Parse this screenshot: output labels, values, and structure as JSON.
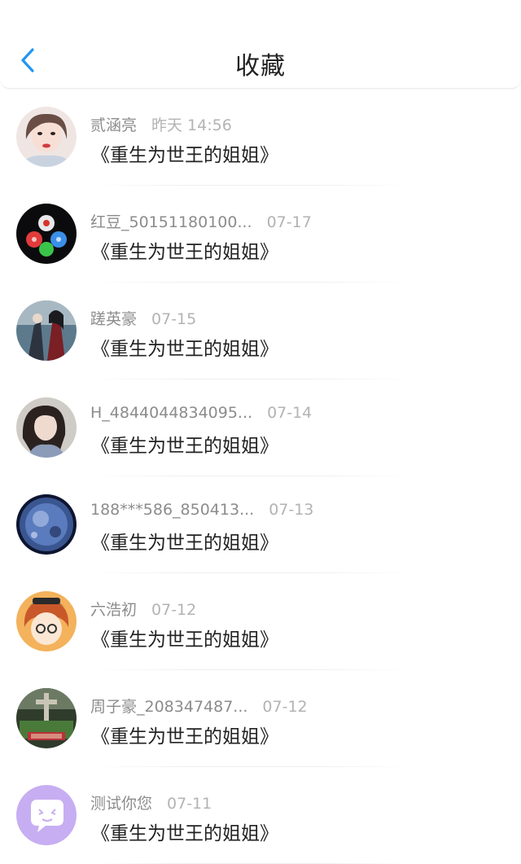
{
  "header": {
    "title": "收藏",
    "back_icon": "chevron-left-icon",
    "accent_color": "#2196f3"
  },
  "favorites": [
    {
      "user": "贰涵亮",
      "time": "昨天 14:56",
      "book": "《重生为世王的姐姐》",
      "avatar": "user-photo"
    },
    {
      "user": "红豆_50151180100...",
      "time": "07-17",
      "book": "《重生为世王的姐姐》",
      "avatar": "colored-dots"
    },
    {
      "user": "蹉英豪",
      "time": "07-15",
      "book": "《重生为世王的姐姐》",
      "avatar": "anime-illustration"
    },
    {
      "user": "H_4844044834095...",
      "time": "07-14",
      "book": "《重生为世王的姐姐》",
      "avatar": "user-photo"
    },
    {
      "user": "188***586_850413...",
      "time": "07-13",
      "book": "《重生为世王的姐姐》",
      "avatar": "planet-art"
    },
    {
      "user": "六浩初",
      "time": "07-12",
      "book": "《重生为世王的姐姐》",
      "avatar": "cartoon-character"
    },
    {
      "user": "周子豪_208347487...",
      "time": "07-12",
      "book": "《重生为世王的姐姐》",
      "avatar": "poster-art"
    },
    {
      "user": "测试你您",
      "time": "07-11",
      "book": "《重生为世王的姐姐》",
      "avatar": "chat-bubble"
    }
  ]
}
